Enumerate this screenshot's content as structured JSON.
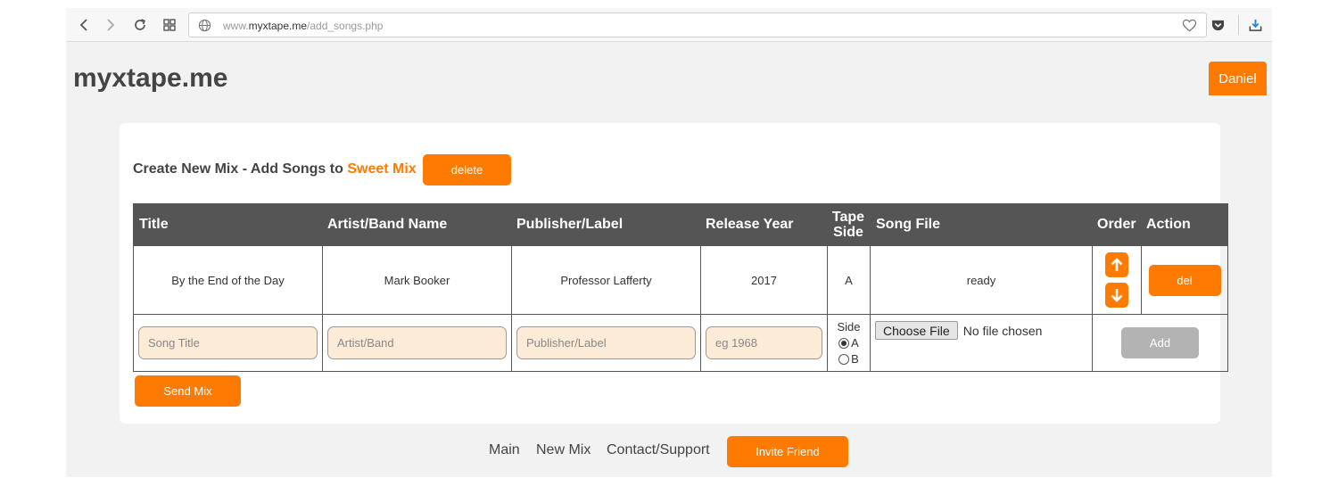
{
  "browser": {
    "url_prefix": "www.",
    "url_host": "myxtape.me",
    "url_path": "/add_songs.php"
  },
  "site": {
    "logo": "myxtape.me",
    "user_button": "Daniel"
  },
  "mix": {
    "heading_prefix": "Create New Mix - Add Songs to",
    "mix_name": "Sweet Mix",
    "delete_label": "delete"
  },
  "table": {
    "headers": {
      "title": "Title",
      "artist": "Artist/Band Name",
      "publisher": "Publisher/Label",
      "year": "Release Year",
      "tape_side_line1": "Tape",
      "tape_side_line2": "Side",
      "song_file": "Song File",
      "order": "Order",
      "action": "Action"
    },
    "rows": [
      {
        "title": "By the End of the Day",
        "artist": "Mark Booker",
        "publisher": "Professor Lafferty",
        "year": "2017",
        "side": "A",
        "file_status": "ready",
        "action_label": "del"
      }
    ],
    "new_row": {
      "title_placeholder": "Song Title",
      "artist_placeholder": "Artist/Band",
      "publisher_placeholder": "Publisher/Label",
      "year_placeholder": "eg 1968",
      "side_label": "Side",
      "side_option_a": "A",
      "side_option_b": "B",
      "side_selected": "A",
      "choose_file_label": "Choose File",
      "no_file_text": "No file chosen",
      "add_label": "Add"
    }
  },
  "send_mix_label": "Send Mix",
  "footer": {
    "links": [
      "Main",
      "New Mix",
      "Contact/Support"
    ],
    "invite_label": "Invite Friend"
  },
  "colors": {
    "accent": "#ff7a00",
    "header_bg": "#555555",
    "input_bg": "#fcebd7",
    "disabled_button": "#b3b3b3"
  }
}
